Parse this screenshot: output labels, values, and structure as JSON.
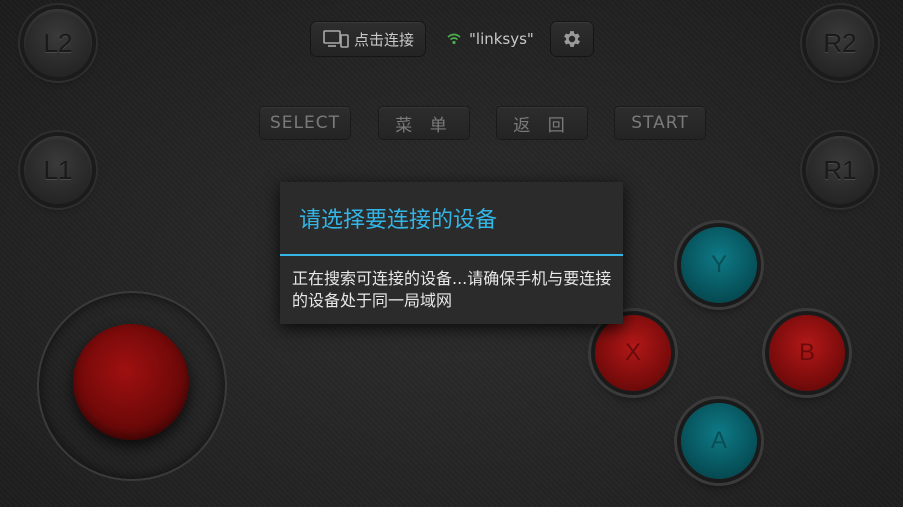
{
  "shoulders": {
    "l2": "L2",
    "r2": "R2",
    "l1": "L1",
    "r1": "R1"
  },
  "topbar": {
    "connect_label": "点击连接",
    "wifi_name": "\"linksys\"",
    "wifi_color": "#4caf50"
  },
  "controls": {
    "select": "SELECT",
    "menu": "菜 单",
    "back": "返 回",
    "start": "START"
  },
  "face_buttons": {
    "y": "Y",
    "x": "X",
    "b": "B",
    "a": "A"
  },
  "dialog": {
    "title": "请选择要连接的设备",
    "message": "正在搜索可连接的设备...请确保手机与要连接的设备处于同一局域网",
    "accent": "#33b5e5"
  }
}
